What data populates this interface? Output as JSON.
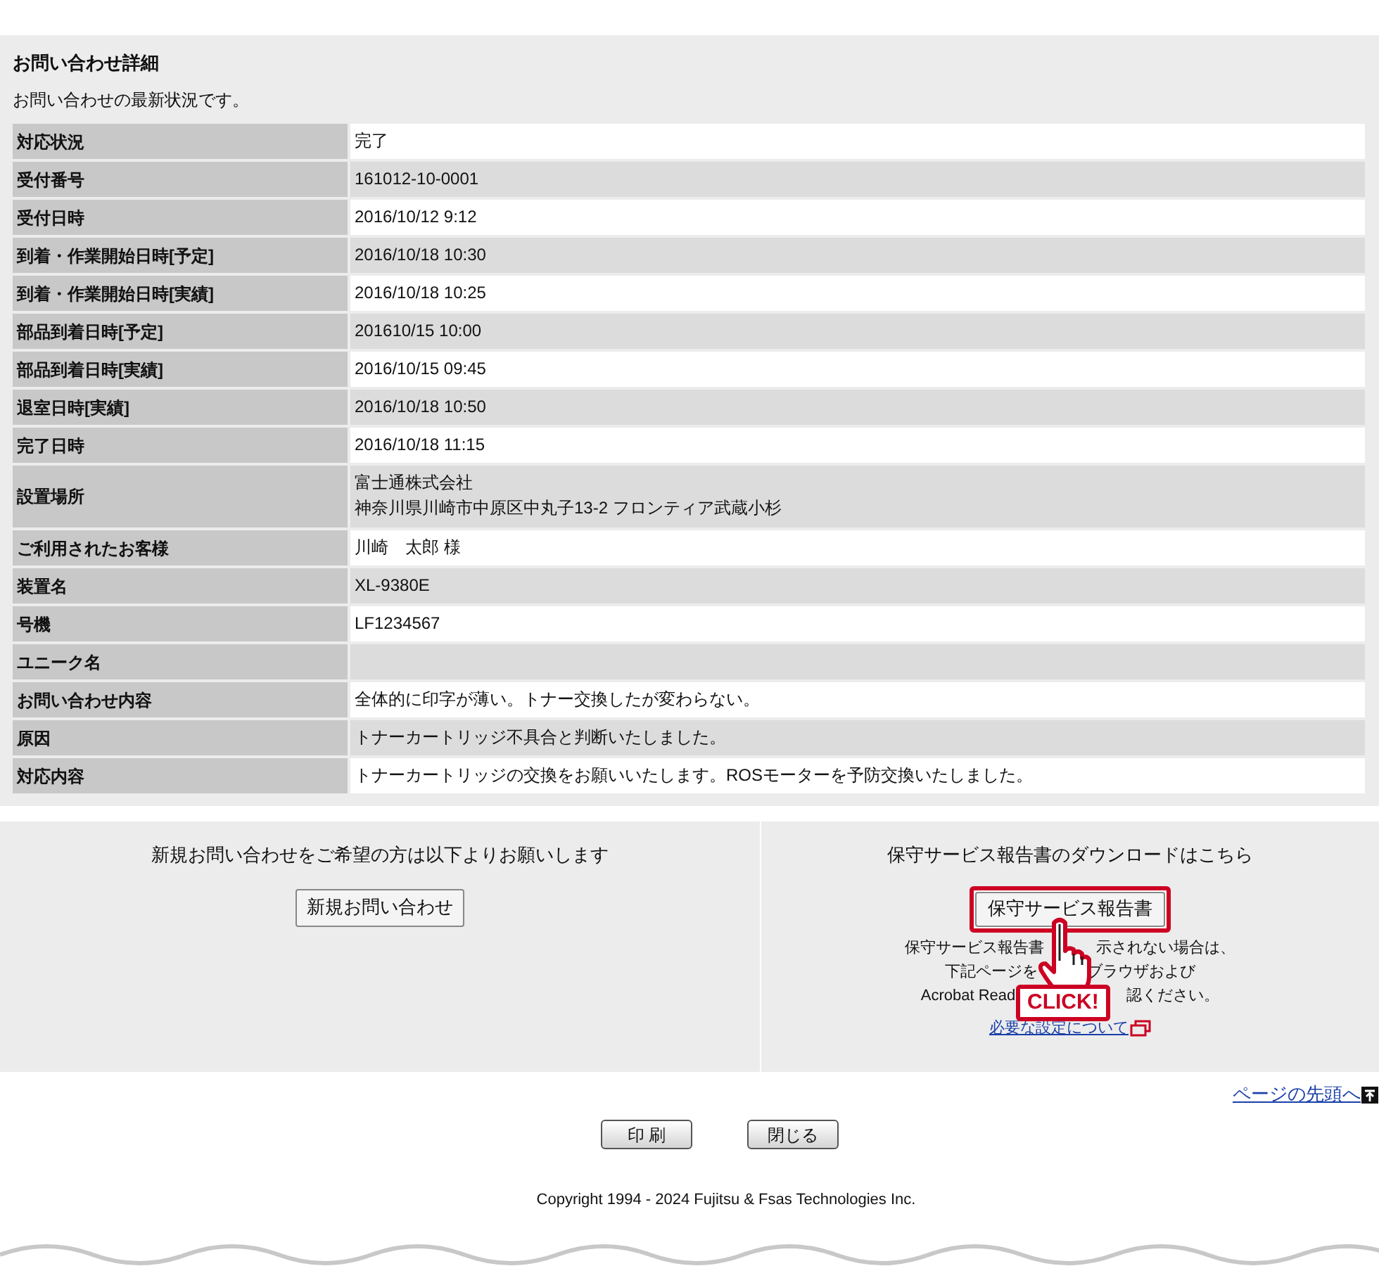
{
  "detail": {
    "title": "お問い合わせ詳細",
    "subtitle": "お問い合わせの最新状況です。",
    "rows": [
      {
        "label": "対応状況",
        "values": [
          "完了"
        ]
      },
      {
        "label": "受付番号",
        "values": [
          "161012-10-0001"
        ]
      },
      {
        "label": "受付日時",
        "values": [
          "2016/10/12 9:12"
        ]
      },
      {
        "label": "到着・作業開始日時[予定]",
        "values": [
          "2016/10/18 10:30"
        ]
      },
      {
        "label": "到着・作業開始日時[実績]",
        "values": [
          "2016/10/18 10:25"
        ]
      },
      {
        "label": "部品到着日時[予定]",
        "values": [
          "201610/15 10:00"
        ]
      },
      {
        "label": "部品到着日時[実績]",
        "values": [
          "2016/10/15 09:45"
        ]
      },
      {
        "label": "退室日時[実績]",
        "values": [
          "2016/10/18 10:50"
        ]
      },
      {
        "label": "完了日時",
        "values": [
          "2016/10/18 11:15"
        ]
      },
      {
        "label": "設置場所",
        "values": [
          "富士通株式会社",
          "神奈川県川崎市中原区中丸子13-2 フロンティア武蔵小杉"
        ]
      },
      {
        "label": "ご利用されたお客様",
        "values": [
          "川崎　太郎  様"
        ]
      },
      {
        "label": "装置名",
        "values": [
          "XL-9380E"
        ]
      },
      {
        "label": "号機",
        "values": [
          "LF1234567"
        ]
      },
      {
        "label": "ユニーク名"
      },
      {
        "label": "お問い合わせ内容",
        "values": [
          "全体的に印字が薄い。トナー交換したが変わらない。"
        ]
      },
      {
        "label": "原因",
        "values": [
          "トナーカートリッジ不具合と判断いたしました。"
        ]
      },
      {
        "label": "対応内容",
        "values": [
          "トナーカートリッジの交換をお願いいたします。ROSモーターを予防交換いたしました。"
        ]
      }
    ]
  },
  "new_inquiry": {
    "text": "新規お問い合わせをご希望の方は以下よりお願いします",
    "button": "新規お問い合わせ"
  },
  "report": {
    "text": "保守サービス報告書のダウンロードはこちら",
    "button": "保守サービス報告書",
    "note_lines": [
      [
        "保守サービス報告書",
        "示されない場合は、"
      ],
      [
        "下記ページを",
        "ブラウザおよび"
      ],
      [
        "Acrobat Read",
        "認ください。"
      ]
    ],
    "link": "必要な設定について",
    "callout": "CLICK!"
  },
  "page_top_link": "ページの先頭へ",
  "buttons": [
    "印 刷",
    "閉じる"
  ],
  "copyright": "Copyright 1994 - 2024 Fujitsu & Fsas Technologies Inc."
}
